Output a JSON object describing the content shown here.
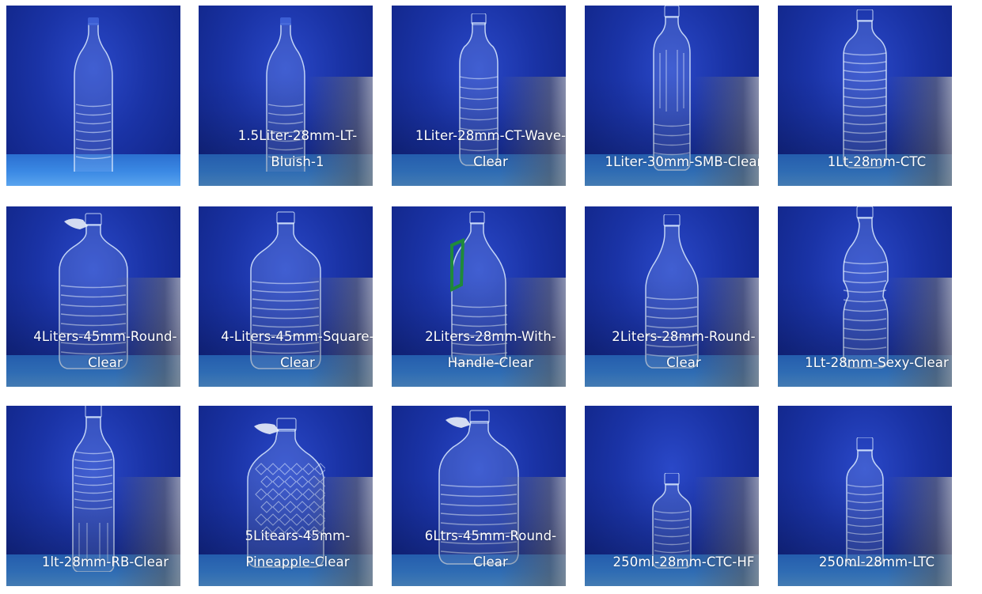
{
  "products": [
    {
      "caption": "",
      "line1": "",
      "line2": ""
    },
    {
      "caption": "1.5Liter-28mm-LT-Bluish-1",
      "line1": "1.5Liter-28mm-LT-",
      "line2": "Bluish-1"
    },
    {
      "caption": "1Liter-28mm-CT-Wave-Clear",
      "line1": "1Liter-28mm-CT-Wave-",
      "line2": "Clear"
    },
    {
      "caption": "1Liter-30mm-SMB-Clear",
      "line1": "1Liter-30mm-SMB-Clear",
      "line2": ""
    },
    {
      "caption": "1Lt-28mm-CTC",
      "line1": "1Lt-28mm-CTC",
      "line2": ""
    },
    {
      "caption": "4Liters-45mm-Round-Clear",
      "line1": "4Liters-45mm-Round-",
      "line2": "Clear"
    },
    {
      "caption": "4-Liters-45mm-Square-Clear",
      "line1": "4-Liters-45mm-Square-",
      "line2": "Clear"
    },
    {
      "caption": "2Liters-28mm-With-Handle-Clear",
      "line1": "2Liters-28mm-With-",
      "line2": "Handle-Clear"
    },
    {
      "caption": "2Liters-28mm-Round-Clear",
      "line1": "2Liters-28mm-Round-",
      "line2": "Clear"
    },
    {
      "caption": "1Lt-28mm-Sexy-Clear",
      "line1": "1Lt-28mm-Sexy-Clear",
      "line2": ""
    },
    {
      "caption": "1lt-28mm-RB-Clear",
      "line1": "1lt-28mm-RB-Clear",
      "line2": ""
    },
    {
      "caption": "5Litears-45mm-Pineapple-Clear",
      "line1": "5Litears-45mm-",
      "line2": "Pineapple-Clear"
    },
    {
      "caption": "6Ltrs-45mm-Round-Clear",
      "line1": "6Ltrs-45mm-Round-",
      "line2": "Clear"
    },
    {
      "caption": "250ml-28mm-CTC-HF",
      "line1": "250ml-28mm-CTC-HF",
      "line2": ""
    },
    {
      "caption": "250ml-28mm-LTC",
      "line1": "250ml-28mm-LTC",
      "line2": ""
    }
  ],
  "colors": {
    "backdrop": "#1a33a6",
    "floor": "#3b89e4",
    "caption_text": "#ffffff",
    "handle_green": "#1f8a3a",
    "cap_blue": "#3f63d8"
  },
  "icons": {
    "bottle": "bottle-icon",
    "handle": "handle-icon"
  }
}
